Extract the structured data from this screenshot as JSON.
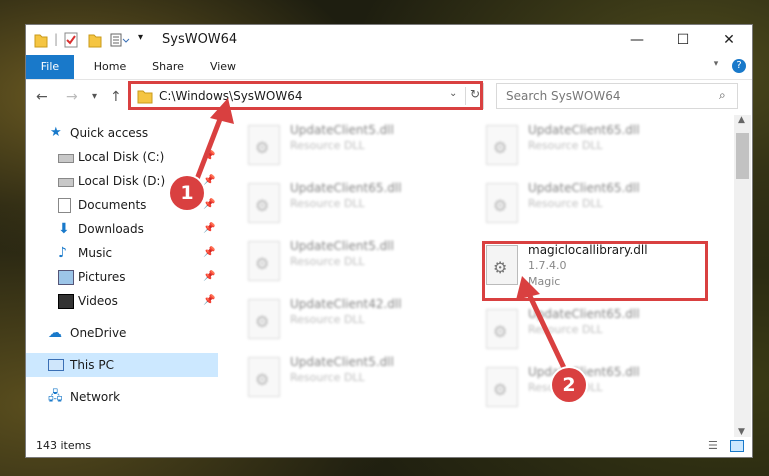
{
  "window": {
    "title": "SysWOW64"
  },
  "ribbon": {
    "tabs": [
      "File",
      "Home",
      "Share",
      "View"
    ]
  },
  "address": {
    "path": "C:\\Windows\\SysWOW64",
    "search_placeholder": "Search SysWOW64"
  },
  "nav": {
    "quick_access": "Quick access",
    "items": [
      "Local Disk (C:)",
      "Local Disk (D:)",
      "Documents",
      "Downloads",
      "Music",
      "Pictures",
      "Videos"
    ],
    "onedrive": "OneDrive",
    "thispc": "This PC",
    "network": "Network"
  },
  "files": [
    {
      "name": "UpdateClient5.dll",
      "desc": "Resource DLL"
    },
    {
      "name": "UpdateClient65.dll",
      "desc": "Resource DLL"
    },
    {
      "name": "UpdateClient65.dll",
      "desc": "Resource DLL"
    },
    {
      "name": "UpdateClient65.dll",
      "desc": "Resource DLL"
    },
    {
      "name": "UpdateClient5.dll",
      "desc": "Resource DLL"
    },
    {
      "name": "UpdateClient42.dll",
      "desc": "Resource DLL"
    },
    {
      "name": "UpdateClient65.dll",
      "desc": "Resource DLL"
    },
    {
      "name": "UpdateClient5.dll",
      "desc": "Resource DLL"
    },
    {
      "name": "UpdateClient65.dll",
      "desc": "Resource DLL"
    }
  ],
  "highlight_file": {
    "name": "magiclocallibrary.dll",
    "version": "1.7.4.0",
    "company": "Magic"
  },
  "status": {
    "count": "143 items"
  },
  "annotations": {
    "badge1": "1",
    "badge2": "2"
  },
  "colors": {
    "accent": "#1979ca",
    "highlight": "#d94040",
    "selected": "#cce8ff"
  }
}
